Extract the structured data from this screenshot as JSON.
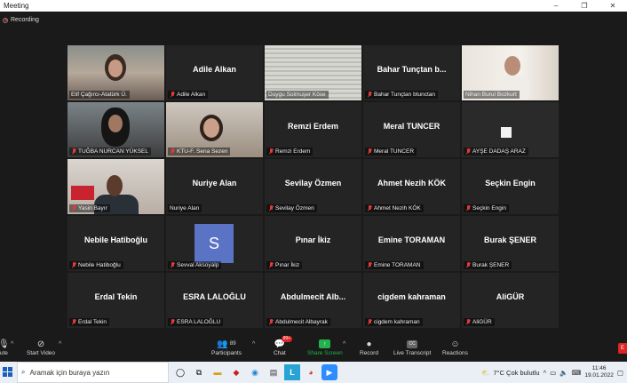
{
  "window": {
    "title": "Meeting",
    "controls": [
      "–",
      "❐",
      "✕"
    ]
  },
  "recording": {
    "label": "Recording"
  },
  "participants": [
    {
      "display": "",
      "label": "Elif Çağırcı-Atatürk Ü.",
      "video": "v1",
      "muted": false
    },
    {
      "display": "Adile Alkan",
      "label": "Adile Alkan",
      "video": "",
      "muted": true
    },
    {
      "display": "",
      "label": "Duygu Solmuşer Köse",
      "video": "v3",
      "muted": false
    },
    {
      "display": "Bahar Tunçtan b...",
      "label": "Bahar Tunçtan btunctan",
      "video": "",
      "muted": true
    },
    {
      "display": "",
      "label": "Nihan Burul Bozkurt",
      "video": "v5",
      "muted": false,
      "active": true
    },
    {
      "display": "",
      "label": "TUĞBA NURCAN YÜKSEL",
      "video": "v6",
      "muted": true
    },
    {
      "display": "",
      "label": "KTU-F. Sena Sezen",
      "video": "v7",
      "muted": true
    },
    {
      "display": "Remzi Erdem",
      "label": "Remzi Erdem",
      "video": "",
      "muted": true
    },
    {
      "display": "Meral TUNCER",
      "label": "Meral TUNCER",
      "video": "",
      "muted": true
    },
    {
      "display": "",
      "label": "AYŞE DADAŞ ARAZ",
      "video": "v10",
      "muted": true
    },
    {
      "display": "",
      "label": "Yasin Bayır",
      "video": "v11",
      "muted": true
    },
    {
      "display": "Nuriye Alan",
      "label": "Nuriye Alan",
      "video": "",
      "muted": false
    },
    {
      "display": "Sevilay Özmen",
      "label": "Sevilay Özmen",
      "video": "",
      "muted": true
    },
    {
      "display": "Ahmet Nezih KÖK",
      "label": "Ahmet Nezih KÖK",
      "video": "",
      "muted": true
    },
    {
      "display": "Seçkin Engin",
      "label": "Seçkin Engin",
      "video": "",
      "muted": true
    },
    {
      "display": "Nebile Hatiboğlu",
      "label": "Nebile Hatiboğlu",
      "video": "",
      "muted": true
    },
    {
      "display": "",
      "label": "Sevval Aksoyalp",
      "video": "avatar",
      "avatar_letter": "S",
      "muted": true
    },
    {
      "display": "Pınar İkiz",
      "label": "Pınar İkiz",
      "video": "",
      "muted": true
    },
    {
      "display": "Emine TORAMAN",
      "label": "Emine TORAMAN",
      "video": "",
      "muted": true
    },
    {
      "display": "Burak ŞENER",
      "label": "Burak ŞENER",
      "video": "",
      "muted": true
    },
    {
      "display": "Erdal Tekin",
      "label": "Erdal Tekin",
      "video": "",
      "muted": true
    },
    {
      "display": "ESRA LALOĞLU",
      "label": "ESRA LALOĞLU",
      "video": "",
      "muted": true
    },
    {
      "display": "Abdulmecit Alb...",
      "label": "Abdulmecit Albayrak",
      "video": "",
      "muted": true
    },
    {
      "display": "cigdem kahraman",
      "label": "cigdem kahraman",
      "video": "",
      "muted": true
    },
    {
      "display": "AliGÜR",
      "label": "AliGÜR",
      "video": "",
      "muted": true
    }
  ],
  "toolbar": {
    "mute_label": "ute",
    "video_label": "Start Video",
    "participants_label": "Participants",
    "participants_count": "89",
    "chat_label": "Chat",
    "chat_badge": "99+",
    "share_label": "Share Screen",
    "record_label": "Record",
    "transcript_label": "Live Transcript",
    "transcript_icon": "CC",
    "reactions_label": "Reactions",
    "end_label": "E"
  },
  "taskbar": {
    "search_placeholder": "Aramak için buraya yazın",
    "weather": "7°C  Çok bulutlu",
    "time": "11:46",
    "date": "19.01.2022"
  },
  "colors": {
    "active_speaker": "#c7e04a",
    "share_green": "#23b14d",
    "mute_red": "#e23b3b",
    "tile_bg": "#242424"
  }
}
